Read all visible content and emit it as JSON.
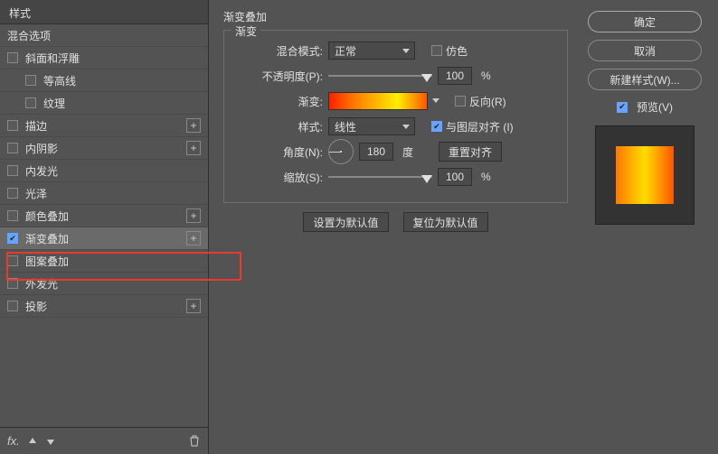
{
  "left": {
    "header": "样式",
    "blend_options": "混合选项",
    "items": [
      {
        "label": "斜面和浮雕",
        "plus": false,
        "indent": false
      },
      {
        "label": "等高线",
        "plus": false,
        "indent": true
      },
      {
        "label": "纹理",
        "plus": false,
        "indent": true
      },
      {
        "label": "描边",
        "plus": true,
        "indent": false
      },
      {
        "label": "内阴影",
        "plus": true,
        "indent": false
      },
      {
        "label": "内发光",
        "plus": false,
        "indent": false
      },
      {
        "label": "光泽",
        "plus": false,
        "indent": false
      },
      {
        "label": "颜色叠加",
        "plus": true,
        "indent": false
      },
      {
        "label": "渐变叠加",
        "plus": true,
        "indent": false,
        "checked": true,
        "selected": true
      },
      {
        "label": "图案叠加",
        "plus": false,
        "indent": false
      },
      {
        "label": "外发光",
        "plus": false,
        "indent": false
      },
      {
        "label": "投影",
        "plus": true,
        "indent": false
      }
    ]
  },
  "mid": {
    "section_title": "渐变叠加",
    "fieldset_title": "渐变",
    "blend_mode_label": "混合模式:",
    "blend_mode_value": "正常",
    "dither_label": "仿色",
    "opacity_label": "不透明度(P):",
    "opacity_value": "100",
    "percent": "%",
    "gradient_label": "渐变:",
    "reverse_label": "反向(R)",
    "style_label": "样式:",
    "style_value": "线性",
    "align_label": "与图层对齐 (I)",
    "angle_label": "角度(N):",
    "angle_value": "180",
    "degree": "度",
    "reset_align": "重置对齐",
    "scale_label": "缩放(S):",
    "scale_value": "100",
    "set_default": "设置为默认值",
    "reset_default": "复位为默认值"
  },
  "right": {
    "ok": "确定",
    "cancel": "取消",
    "new_style": "新建样式(W)...",
    "preview": "预览(V)"
  }
}
